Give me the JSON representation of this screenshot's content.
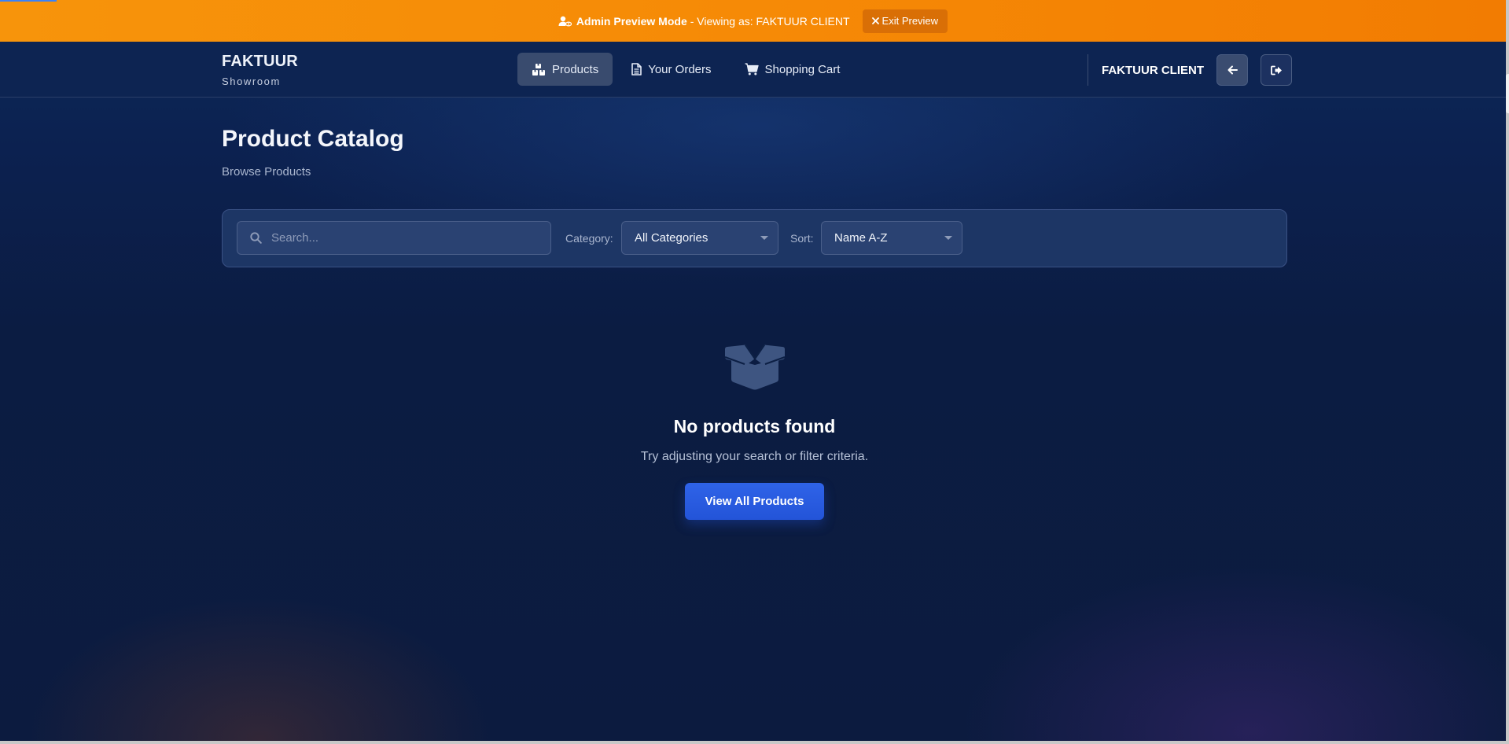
{
  "preview_banner": {
    "mode_label": "Admin Preview Mode",
    "viewing_as": "- Viewing as: FAKTUUR CLIENT",
    "exit_label": "Exit Preview",
    "background_color": "#f68a06"
  },
  "brand": {
    "name": "FAKTUUR",
    "subtitle": "Showroom"
  },
  "nav": {
    "items": [
      {
        "label": "Products",
        "icon": "boxes-icon",
        "active": true
      },
      {
        "label": "Your Orders",
        "icon": "document-icon",
        "active": false
      },
      {
        "label": "Shopping Cart",
        "icon": "cart-icon",
        "active": false
      }
    ],
    "client_name": "FAKTUUR CLIENT"
  },
  "page": {
    "title": "Product Catalog",
    "subtitle": "Browse Products"
  },
  "filters": {
    "search_placeholder": "Search...",
    "search_value": "",
    "category_label": "Category:",
    "category_value": "All Categories",
    "sort_label": "Sort:",
    "sort_value": "Name A-Z"
  },
  "empty_state": {
    "icon": "open-box-icon",
    "title": "No products found",
    "description": "Try adjusting your search or filter criteria.",
    "button_label": "View All Products"
  },
  "colors": {
    "accent_blue": "#2354d8",
    "page_background": "#0c1f44"
  }
}
